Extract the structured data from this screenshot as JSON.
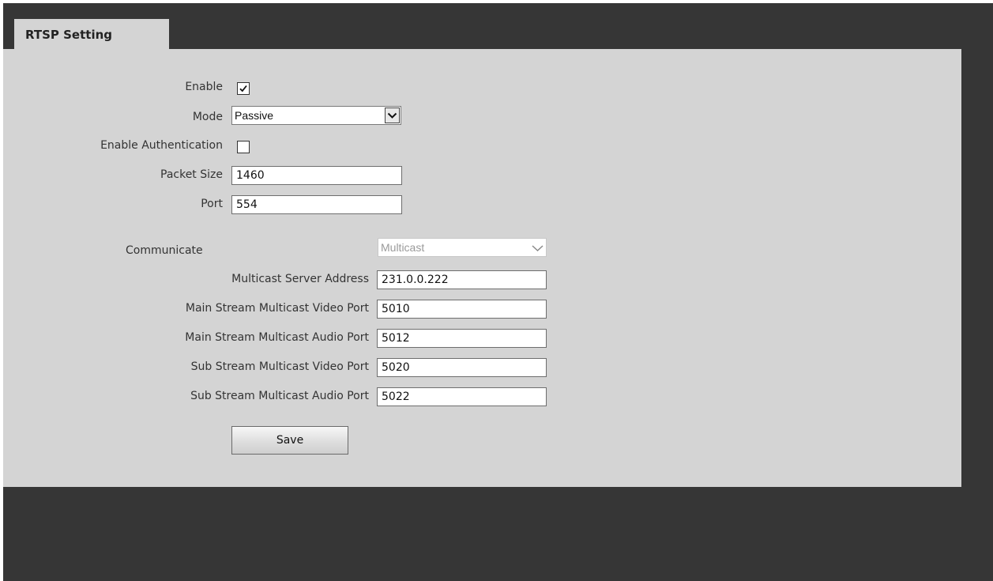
{
  "tab": {
    "title": "RTSP Setting"
  },
  "form": {
    "enable": {
      "label": "Enable",
      "checked": true
    },
    "mode": {
      "label": "Mode",
      "value": "Passive"
    },
    "enable_authentication": {
      "label": "Enable Authentication",
      "checked": false
    },
    "packet_size": {
      "label": "Packet Size",
      "value": "1460"
    },
    "port": {
      "label": "Port",
      "value": "554"
    }
  },
  "multicast": {
    "communicate": {
      "label": "Communicate",
      "value": "Multicast",
      "disabled": true
    },
    "server_address": {
      "label": "Multicast Server Address",
      "value": "231.0.0.222"
    },
    "main_video_port": {
      "label": "Main Stream Multicast Video Port",
      "value": "5010"
    },
    "main_audio_port": {
      "label": "Main Stream Multicast Audio Port",
      "value": "5012"
    },
    "sub_video_port": {
      "label": "Sub Stream Multicast Video Port",
      "value": "5020"
    },
    "sub_audio_port": {
      "label": "Sub Stream Multicast Audio Port",
      "value": "5022"
    }
  },
  "actions": {
    "save_label": "Save"
  },
  "icons": {
    "checkmark": "checkmark-icon",
    "dropdown": "chevron-down-icon"
  },
  "colors": {
    "background": "#363636",
    "panel": "#d4d4d4"
  }
}
